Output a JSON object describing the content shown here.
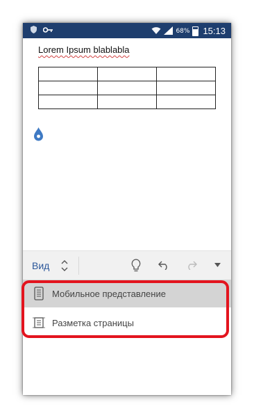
{
  "status_bar": {
    "battery_percent": "68%",
    "time": "15:13",
    "bg_color": "#1e3e6e",
    "icons": [
      "shield-icon",
      "key-icon",
      "wifi-icon",
      "signal-icon",
      "battery-icon"
    ]
  },
  "document": {
    "title": "Lorem Ipsum blablabla",
    "table": {
      "rows": 3,
      "cols": 3
    },
    "cursor_color": "#3f7ac4"
  },
  "toolbar": {
    "view_label": "Вид",
    "accent_color": "#2b579a",
    "icons": [
      "updown-chevron-icon",
      "lightbulb-icon",
      "undo-icon",
      "redo-icon",
      "dropdown-arrow-icon"
    ]
  },
  "view_menu": {
    "items": [
      {
        "label": "Мобильное представление",
        "icon": "mobile-view-icon",
        "selected": true
      },
      {
        "label": "Разметка страницы",
        "icon": "page-layout-icon",
        "selected": false
      }
    ],
    "highlight_color": "#e3141e"
  }
}
